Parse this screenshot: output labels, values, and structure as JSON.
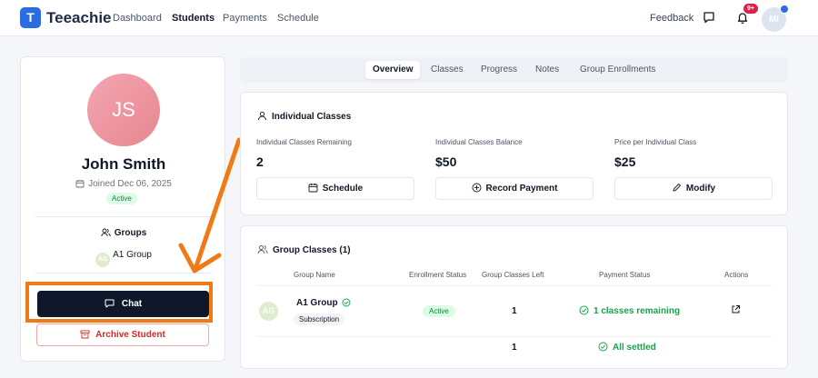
{
  "app": {
    "logo_letter": "T",
    "name": "Teeachie"
  },
  "nav": {
    "links": [
      {
        "label": "Dashboard"
      },
      {
        "label": "Students"
      },
      {
        "label": "Payments"
      },
      {
        "label": "Schedule"
      }
    ],
    "feedback": "Feedback",
    "notification_badge": "9+",
    "user_initials": "MI"
  },
  "student": {
    "initials": "JS",
    "name": "John Smith",
    "joined": "Joined Dec 06, 2025",
    "status": "Active",
    "groups_title": "Groups",
    "group_initials": "AG",
    "group_name": "A1 Group",
    "chat_label": "Chat",
    "archive_label": "Archive Student"
  },
  "tabs": [
    {
      "label": "Overview"
    },
    {
      "label": "Classes"
    },
    {
      "label": "Progress"
    },
    {
      "label": "Notes"
    },
    {
      "label": "Group Enrollments"
    }
  ],
  "individual": {
    "title": "Individual Classes",
    "stats": [
      {
        "label": "Individual Classes Remaining",
        "value": "2",
        "button": "Schedule"
      },
      {
        "label": "Individual Classes Balance",
        "value": "$50",
        "button": "Record Payment"
      },
      {
        "label": "Price per Individual Class",
        "value": "$25",
        "button": "Modify"
      }
    ]
  },
  "group_classes": {
    "title": "Group Classes (1)",
    "headers": [
      "Group Name",
      "Enrollment Status",
      "Group Classes Left",
      "Payment Status",
      "Actions"
    ],
    "row": {
      "initials": "AG",
      "name": "A1 Group",
      "type": "Subscription",
      "status": "Active",
      "classes_left": "1",
      "payment_status": "1 classes remaining"
    },
    "footer": {
      "classes_left": "1",
      "payment_status": "All settled"
    }
  },
  "colors": {
    "brand": "#2b6de0",
    "highlight": "#f07b16",
    "success": "#16a34a",
    "danger": "#dc2626"
  }
}
